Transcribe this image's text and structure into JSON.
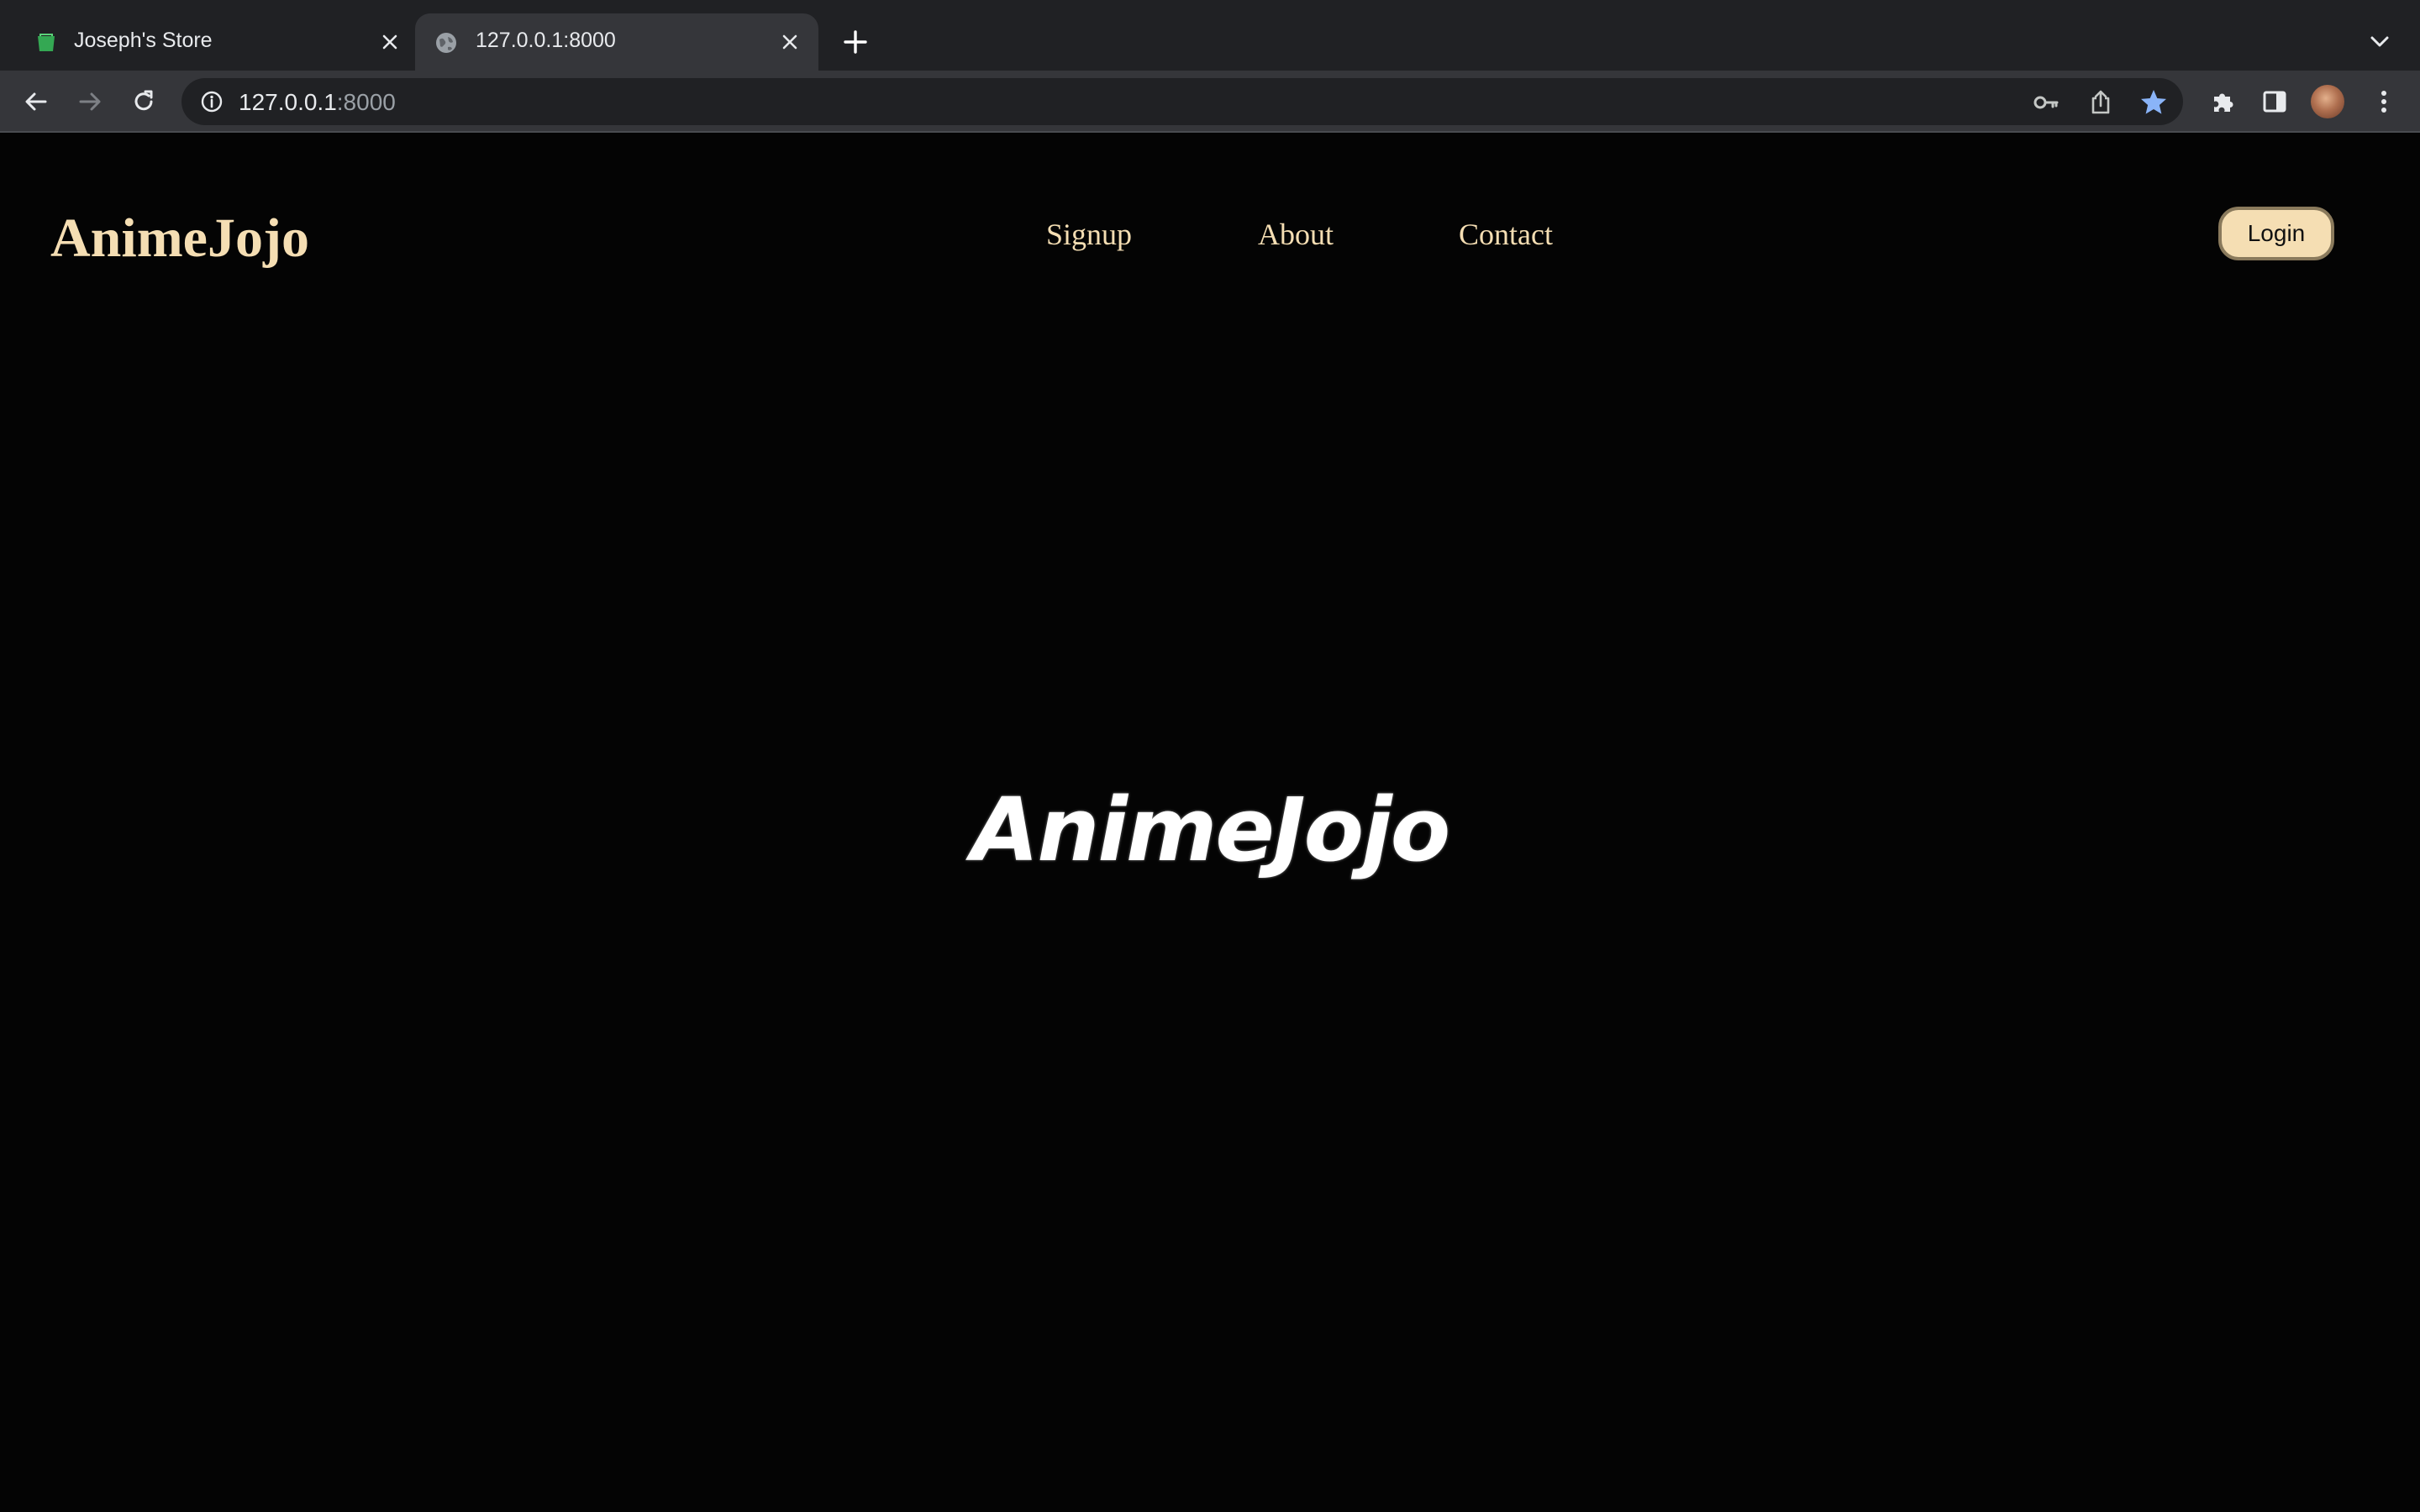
{
  "browser": {
    "tabs": [
      {
        "title": "Joseph's Store",
        "active": false,
        "favicon": "store-favicon-icon"
      },
      {
        "title": "127.0.0.1:8000",
        "active": true,
        "favicon": "globe-icon"
      }
    ],
    "omnibox": {
      "host": "127.0.0.1",
      "port": ":8000"
    },
    "bookmark_star_color": "#8ab4f8"
  },
  "site": {
    "brand": "AnimeJojo",
    "nav": {
      "signup": "Signup",
      "about": "About",
      "contact": "Contact"
    },
    "login_label": "Login",
    "hero_logo_text": "AnimeJojo",
    "accent_color": "#f5deb3",
    "background_color": "#040404"
  }
}
